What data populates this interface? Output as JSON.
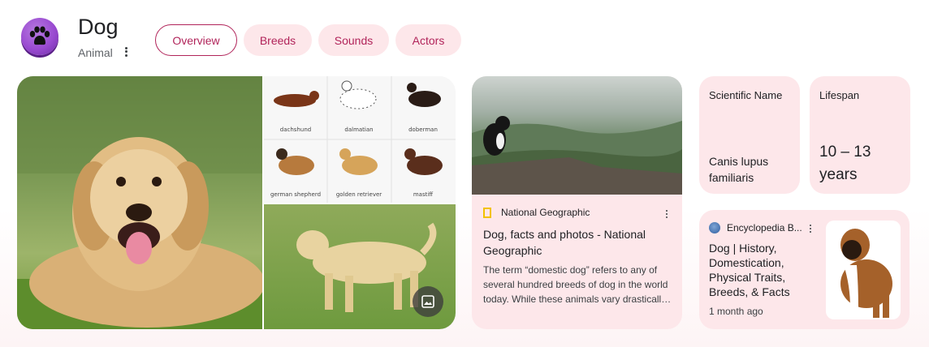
{
  "header": {
    "title": "Dog",
    "subtitle": "Animal",
    "avatar_icon": "paw-icon",
    "tabs": [
      {
        "label": "Overview",
        "active": true
      },
      {
        "label": "Breeds",
        "active": false
      },
      {
        "label": "Sounds",
        "active": false
      },
      {
        "label": "Actors",
        "active": false
      }
    ]
  },
  "images": {
    "main": "golden retriever photo",
    "breeds_chart": {
      "labels": [
        "dachshund",
        "dalmatian",
        "doberman",
        "german shepherd",
        "golden retriever",
        "mastiff"
      ]
    },
    "lab": "labrador photo",
    "more_images_icon": "image-icon"
  },
  "news_card": {
    "source": "National Geographic",
    "title": "Dog, facts and photos - National Geographic",
    "snippet": "The term “domestic dog” refers to any of several hundred breeds of dog in the world today. While these animals vary drastically in size, shape, and coat..."
  },
  "facts": [
    {
      "label": "Scientific Name",
      "value": "Canis lupus familiaris"
    },
    {
      "label": "Lifespan",
      "value": "10 – 13 years"
    }
  ],
  "encyclopedia_card": {
    "source": "Encyclopedia B...",
    "title": "Dog | History, Domestication, Physical Traits, Breeds, & Facts",
    "time": "1 month ago"
  },
  "colors": {
    "accent": "#b1245a",
    "chip_bg": "#fde7ea",
    "avatar": "#9a4bd1"
  }
}
